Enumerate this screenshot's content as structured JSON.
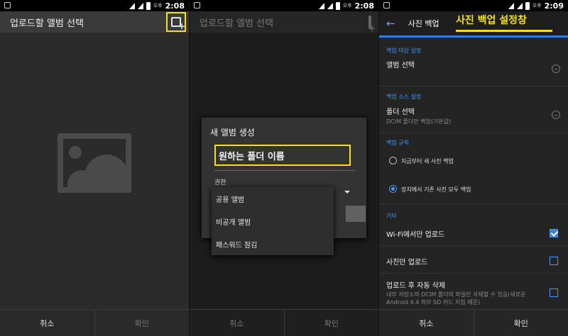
{
  "status": {
    "screen1_ampm": "오후",
    "screen1_time": "2:08",
    "screen2_ampm": "오후",
    "screen2_time": "2:08",
    "screen3_ampm": "오후",
    "screen3_time": "2:09"
  },
  "screen1": {
    "title": "업로드할 앨범 선택",
    "cancel": "취소",
    "ok": "확인"
  },
  "screen2": {
    "title": "업로드할 앨범 선택",
    "dialog_title": "새 앨범 생성",
    "name_value": "원하는 폴더 이름",
    "permission_label": "권한",
    "options": [
      "공용 앨범",
      "비공개 앨범",
      "패스워드 잠김"
    ],
    "cancel": "취소",
    "ok": "확인"
  },
  "screen3": {
    "title": "사진 백업",
    "callout": "사진 백업 설정창",
    "sec_target": "백업 대상 설정",
    "album_select": "앨범 선택",
    "sec_source": "백업 소스 설정",
    "folder_select": "폴더 선택",
    "folder_sub": "DCIM 폴더만 백업(기본값)",
    "sec_rule": "백업 규칙",
    "rule1": "지금부터 새 사진 백업",
    "rule2": "장치에서 기존 사진 모두 백업",
    "sec_other": "기타",
    "wifi_only": "Wi-Fi에서만 업로드",
    "photos_only": "사진만 업로드",
    "auto_delete": "업로드 후 자동 삭제",
    "auto_delete_sub": "내부 저장소의 DCIM 폴더의 파일만 삭제할 수 있음(새로운 Android 4.4 외부 SD 카드 지침 때문)",
    "cancel": "취소",
    "ok": "확인"
  },
  "colors": {
    "accent": "#2f7de1",
    "highlight": "#f5e011"
  }
}
